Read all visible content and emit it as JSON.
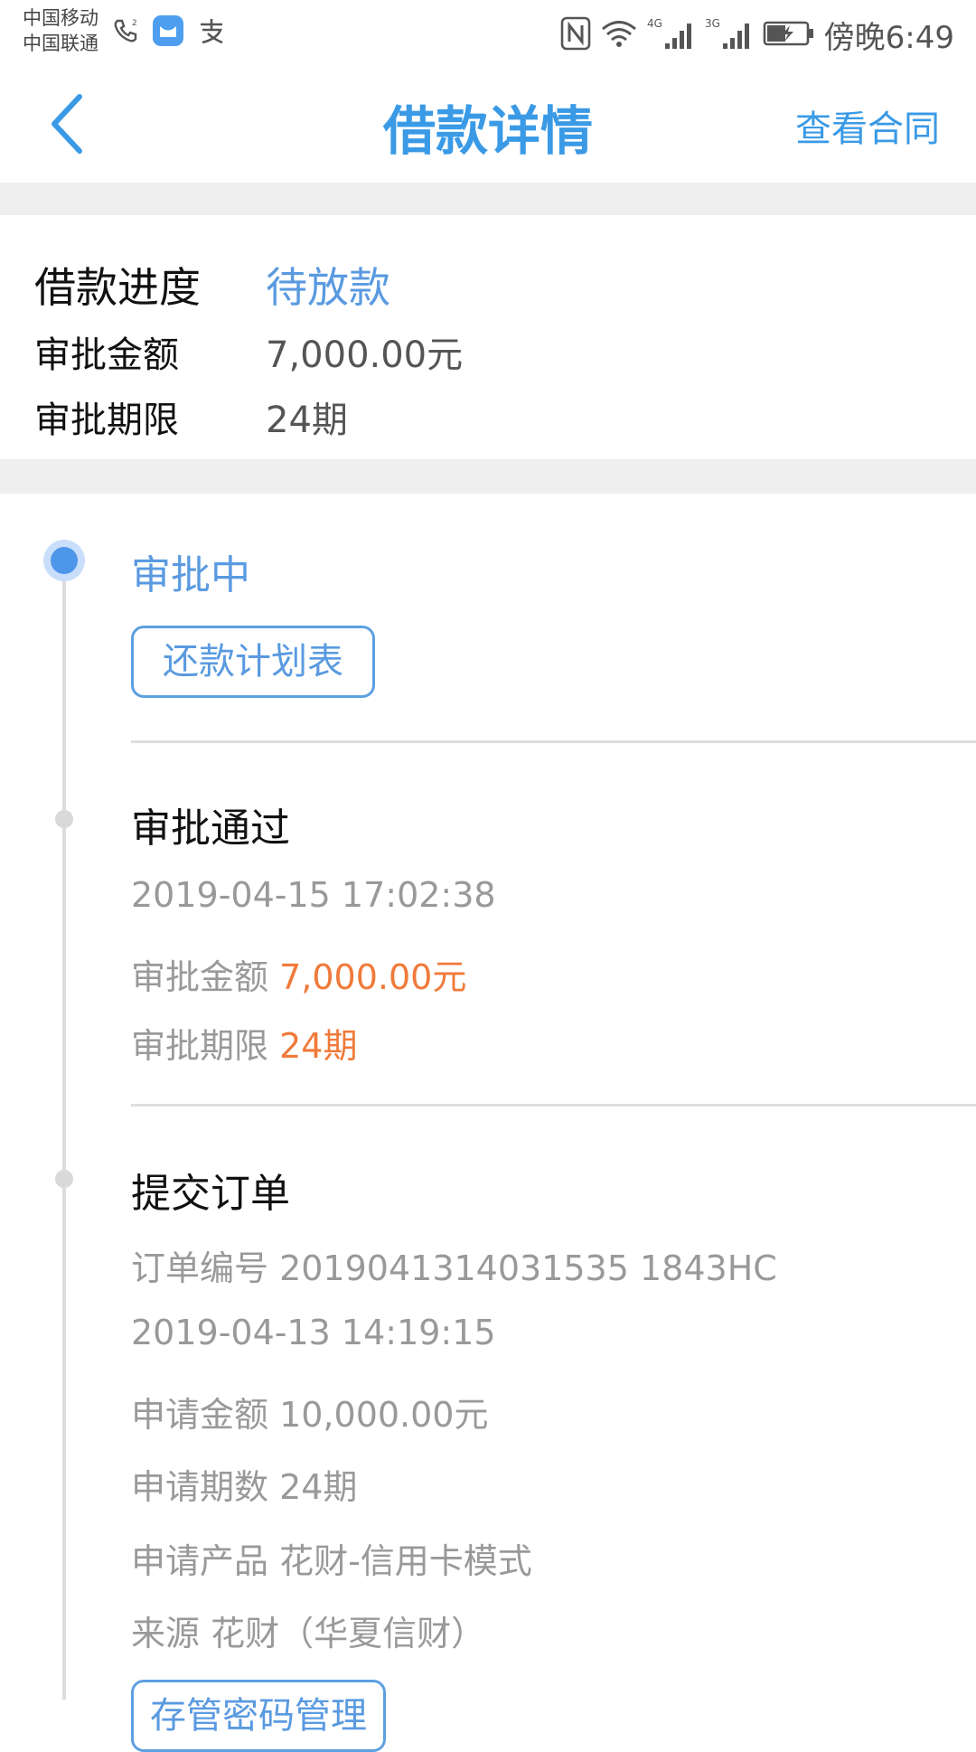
{
  "status_bar": {
    "carrier1": "中国移动",
    "carrier2": "中国联通",
    "time": "傍晚6:49",
    "icons": [
      "call-icon",
      "message-app-icon",
      "alipay-icon",
      "nfc-icon",
      "wifi-icon",
      "signal-4g-icon",
      "signal-3g-icon",
      "battery-icon"
    ]
  },
  "nav": {
    "back_icon": "chevron-left-icon",
    "title": "借款详情",
    "contract_link": "查看合同"
  },
  "summary": {
    "progress_label": "借款进度",
    "progress_value": "待放款",
    "amount_label": "审批金额",
    "amount_value": "7,000.00元",
    "term_label": "审批期限",
    "term_value": "24期"
  },
  "timeline": {
    "step1": {
      "title": "审批中",
      "button": "还款计划表"
    },
    "step2": {
      "title": "审批通过",
      "time": "2019-04-15 17:02:38",
      "amount_label": "审批金额",
      "amount_value": "7,000.00元",
      "term_label": "审批期限",
      "term_value": "24期"
    },
    "step3": {
      "title": "提交订单",
      "order_no": "订单编号 2019041314031535 1843HC",
      "time": "2019-04-13 14:19:15",
      "apply_amount": "申请金额 10,000.00元",
      "apply_term": "申请期数 24期",
      "apply_product": "申请产品 花财-信用卡模式",
      "source": "来源 花财（华夏信财）",
      "button": "存管密码管理"
    }
  },
  "colors": {
    "accent": "#3a9ae6",
    "orange": "#f07a3a",
    "muted": "#999999",
    "band": "#efefef"
  }
}
